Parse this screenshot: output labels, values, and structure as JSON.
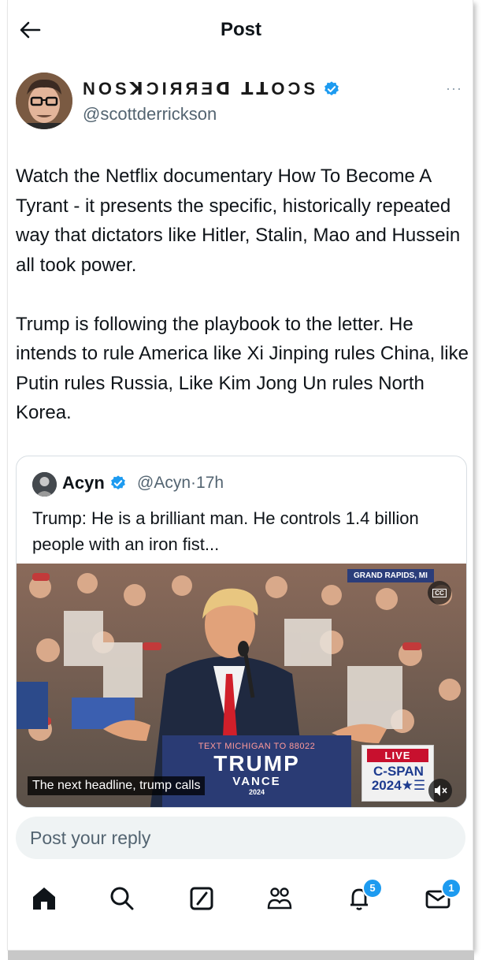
{
  "header": {
    "title": "Post",
    "back_icon": "arrow-left-icon"
  },
  "author": {
    "display_name": "NOSꓘƆIЯЯƎᗡ ꓕꓕOƆS",
    "handle": "@scottderrickson",
    "verified": true,
    "more_icon": "more-horizontal-icon",
    "more_label": "···"
  },
  "post": {
    "paragraphs": [
      "Watch the Netflix documentary How To Become A Tyrant - it presents the specific, historically repeated way that dictators like Hitler, Stalin, Mao and Hussein all took power.",
      "Trump is following the playbook to the letter. He intends to rule America like Xi Jinping rules China, like Putin rules Russia, Like Kim Jong Un rules North Korea."
    ]
  },
  "quote": {
    "name": "Acyn",
    "handle": "@Acyn",
    "separator": "·",
    "time": "17h",
    "verified": true,
    "text": "Trump: He is a brilliant man. He controls 1.4 billion people with an iron fist...",
    "video": {
      "location_badge": "GRAND RAPIDS, MI",
      "cc_label": "CC",
      "podium_line1": "TEXT MICHIGAN TO 88022",
      "podium_line2": "TRUMP",
      "podium_line3": "VANCE",
      "podium_line4": "2024",
      "caption": "The next headline, trump calls",
      "live_label": "LIVE",
      "network": "C-SPAN",
      "network_year": "2024★☰",
      "mute_icon": "volume-mute-icon"
    }
  },
  "reply": {
    "placeholder": "Post your reply"
  },
  "tabbar": {
    "items": [
      {
        "icon": "home-icon"
      },
      {
        "icon": "search-icon"
      },
      {
        "icon": "grok-icon"
      },
      {
        "icon": "communities-icon"
      },
      {
        "icon": "notifications-icon",
        "badge": "5"
      },
      {
        "icon": "messages-icon",
        "badge": "1"
      }
    ]
  },
  "colors": {
    "accent": "#1d9bf0",
    "text": "#0f1419",
    "muted": "#536471"
  }
}
